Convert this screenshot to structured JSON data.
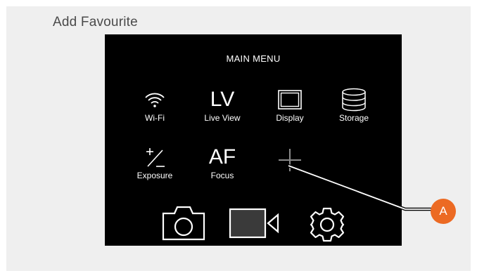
{
  "page": {
    "heading": "Add Favourite"
  },
  "menu": {
    "title": "MAIN MENU",
    "items": [
      {
        "label": "Wi-Fi",
        "icon": "wifi-icon"
      },
      {
        "label": "Live View",
        "glyph": "LV"
      },
      {
        "label": "Display",
        "icon": "display-icon"
      },
      {
        "label": "Storage",
        "icon": "storage-icon"
      },
      {
        "label": "Exposure",
        "glyph_top": "+",
        "glyph_bottom": "−"
      },
      {
        "label": "Focus",
        "glyph": "AF"
      },
      {
        "label": "",
        "icon": "add-icon"
      }
    ],
    "bottom": [
      {
        "icon": "camera-icon"
      },
      {
        "icon": "video-camera-icon"
      },
      {
        "icon": "settings-gear-icon"
      }
    ]
  },
  "callout": {
    "label": "A",
    "color": "#ec6a23"
  },
  "colors": {
    "screen": "#000000",
    "panel": "#efefef",
    "add_icon": "#8a8a8a"
  }
}
